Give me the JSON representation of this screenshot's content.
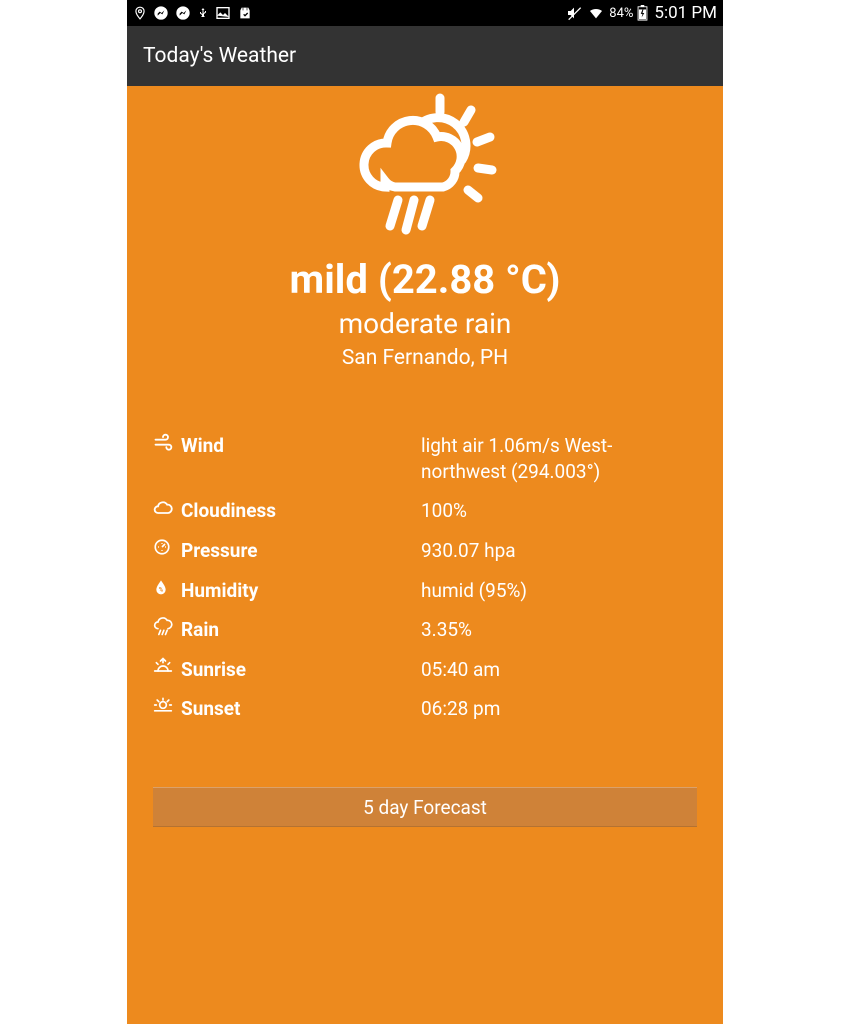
{
  "status_bar": {
    "battery_pct": "84%",
    "clock": "5:01 PM"
  },
  "app_bar": {
    "title": "Today's Weather"
  },
  "main": {
    "temp_line": "mild (22.88 °C)",
    "condition": "moderate rain",
    "location": "San Fernando, PH"
  },
  "details": [
    {
      "label": "Wind",
      "value": "light air 1.06m/s West-northwest (294.003°)"
    },
    {
      "label": "Cloudiness",
      "value": "100%"
    },
    {
      "label": "Pressure",
      "value": "930.07 hpa"
    },
    {
      "label": "Humidity",
      "value": "humid (95%)"
    },
    {
      "label": "Rain",
      "value": "3.35%"
    },
    {
      "label": "Sunrise",
      "value": "05:40 am"
    },
    {
      "label": "Sunset",
      "value": "06:28 pm"
    }
  ],
  "forecast_button": "5 day Forecast"
}
